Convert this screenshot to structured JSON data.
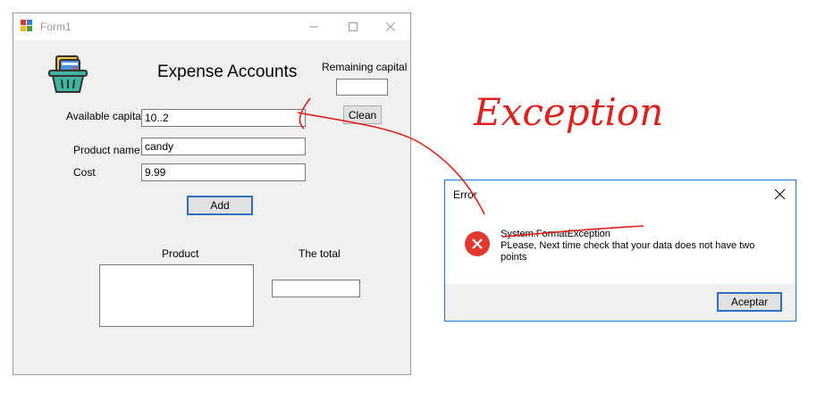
{
  "form": {
    "title": "Form1",
    "heading": "Expense Accounts",
    "remaining_capital_label": "Remaining capital",
    "remaining_capital_value": "",
    "clean_label": "Clean",
    "available_capital_label": "Available capital",
    "available_capital_value": "10..2",
    "product_name_label": "Product name",
    "product_name_value": "candy",
    "cost_label": "Cost",
    "cost_value": "9.99",
    "add_label": "Add",
    "product_label": "Product",
    "total_label": "The total",
    "total_value": ""
  },
  "error_dialog": {
    "title": "Error",
    "exception": "System.FormatException",
    "message": " PLease, Next time check that your data does not have two points",
    "ok_label": "Aceptar"
  },
  "annotation": {
    "text": "Exception",
    "color": "#e0201c"
  },
  "icons": [
    "app-icon",
    "minimize-icon",
    "maximize-icon",
    "close-icon",
    "basket-icon",
    "error-icon"
  ]
}
